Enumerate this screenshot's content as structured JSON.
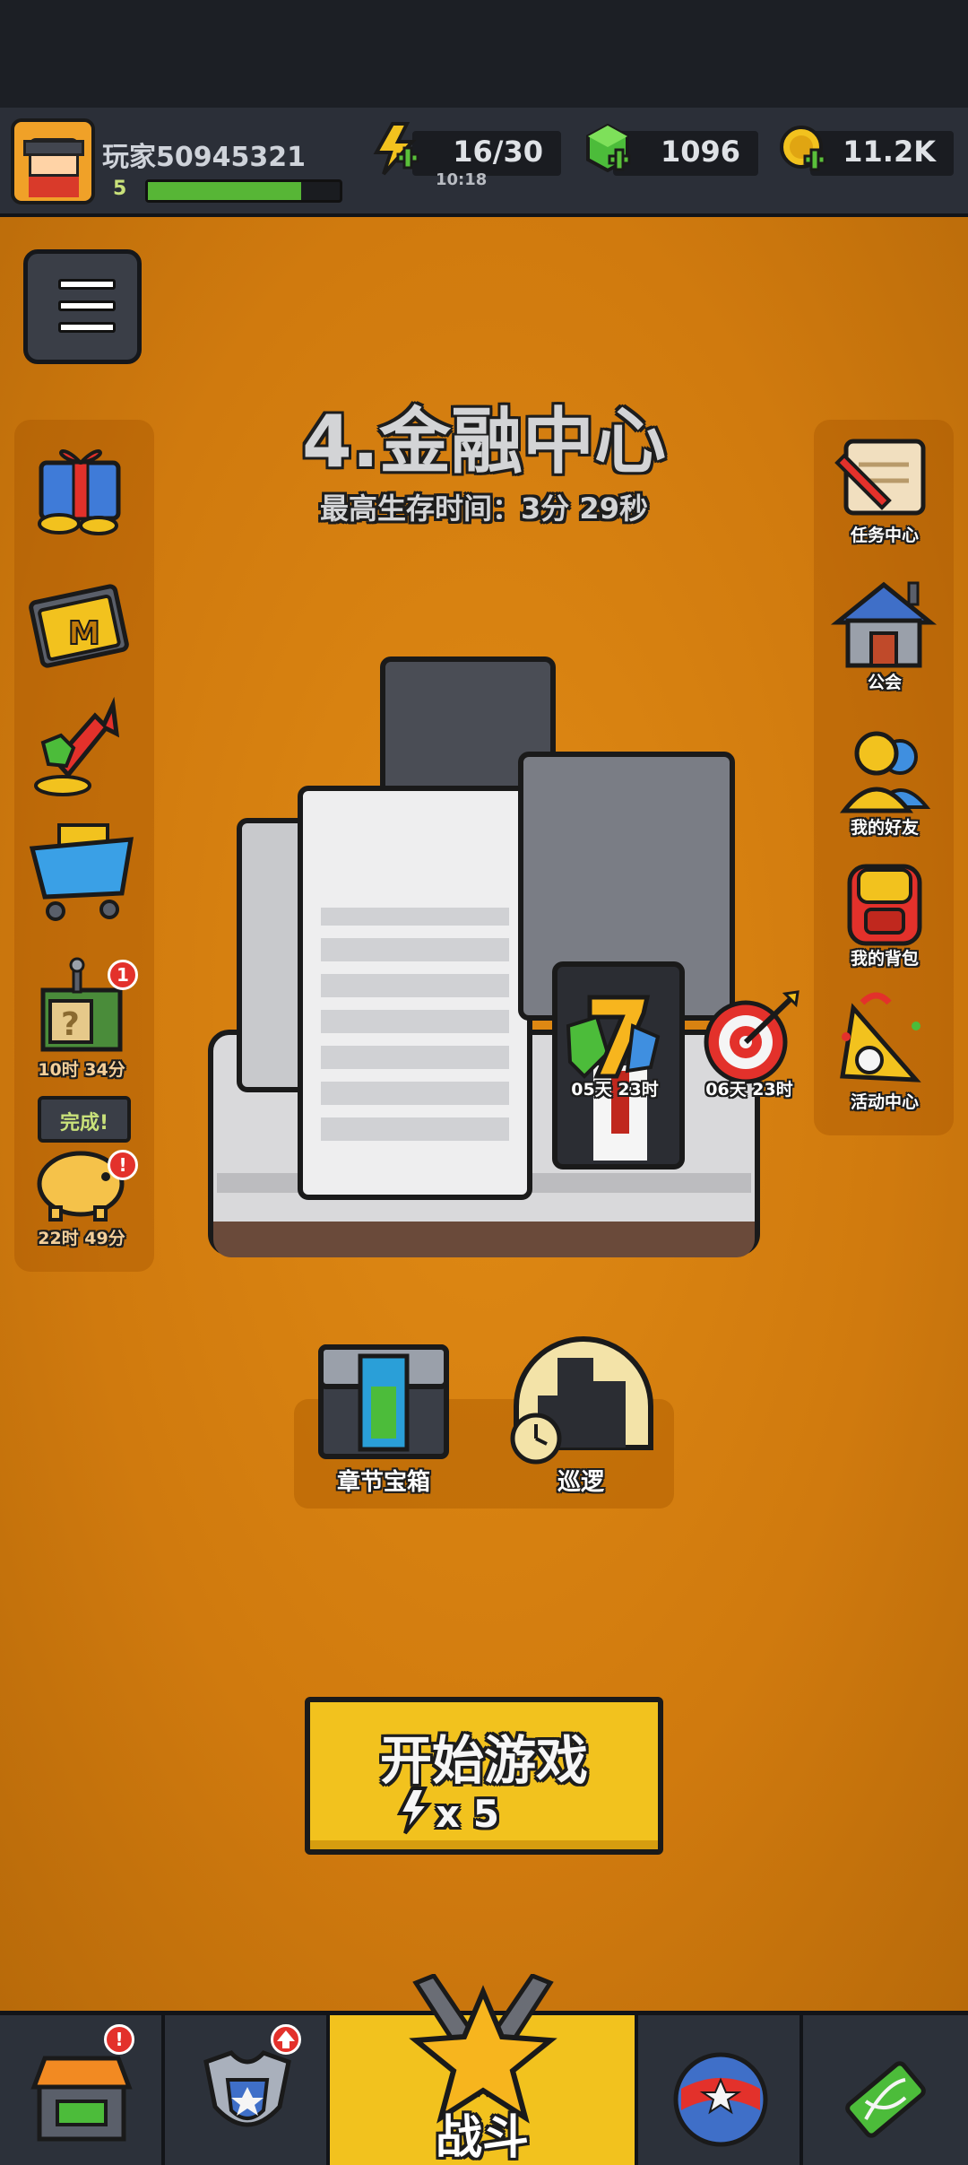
{
  "header": {
    "player_name": "玩家50945321",
    "level": "5",
    "xp_fraction": 0.8,
    "energy": "16/30",
    "energy_timer": "10:18",
    "gems": "1096",
    "coins": "11.2K"
  },
  "stage": {
    "title": "4.金融中心",
    "best_time": "最高生存时间：3分 29秒"
  },
  "left_items": [
    {
      "icon": "gift-box-icon"
    },
    {
      "icon": "monthly-card-icon"
    },
    {
      "icon": "growth-fund-icon"
    },
    {
      "icon": "shop-cart-icon"
    },
    {
      "icon": "mystery-crate-icon",
      "badge": "1",
      "timer": "10时 34分"
    },
    {
      "icon": "piggy-bank-icon",
      "tag": "完成!",
      "badge": "!",
      "timer": "22时 49分"
    }
  ],
  "right_items": [
    {
      "icon": "task-scroll-icon",
      "label": "任务中心"
    },
    {
      "icon": "guild-house-icon",
      "label": "公会"
    },
    {
      "icon": "friends-icon",
      "label": "我的好友"
    },
    {
      "icon": "backpack-icon",
      "label": "我的背包"
    },
    {
      "icon": "event-megaphone-icon",
      "label": "活动中心"
    }
  ],
  "events": [
    {
      "icon": "lucky-seven-icon",
      "timer": "05天 23时"
    },
    {
      "icon": "target-icon",
      "timer": "06天 23时"
    }
  ],
  "chapter": {
    "chest_label": "章节宝箱",
    "patrol_label": "巡逻"
  },
  "start_button": {
    "label": "开始游戏",
    "cost": "x 5"
  },
  "bottom_nav": [
    {
      "icon": "shop-stall-icon",
      "badge": "!"
    },
    {
      "icon": "armor-icon",
      "badge": "upgrade"
    },
    {
      "icon": "crossed-swords-star-icon",
      "label": "战斗",
      "active": true
    },
    {
      "icon": "talent-ball-icon"
    },
    {
      "icon": "dna-evolution-icon"
    }
  ],
  "colors": {
    "background_orange": "#d07a0e",
    "button_yellow": "#f2c21e",
    "badge_red": "#e3312b",
    "xp_green": "#57b636"
  }
}
